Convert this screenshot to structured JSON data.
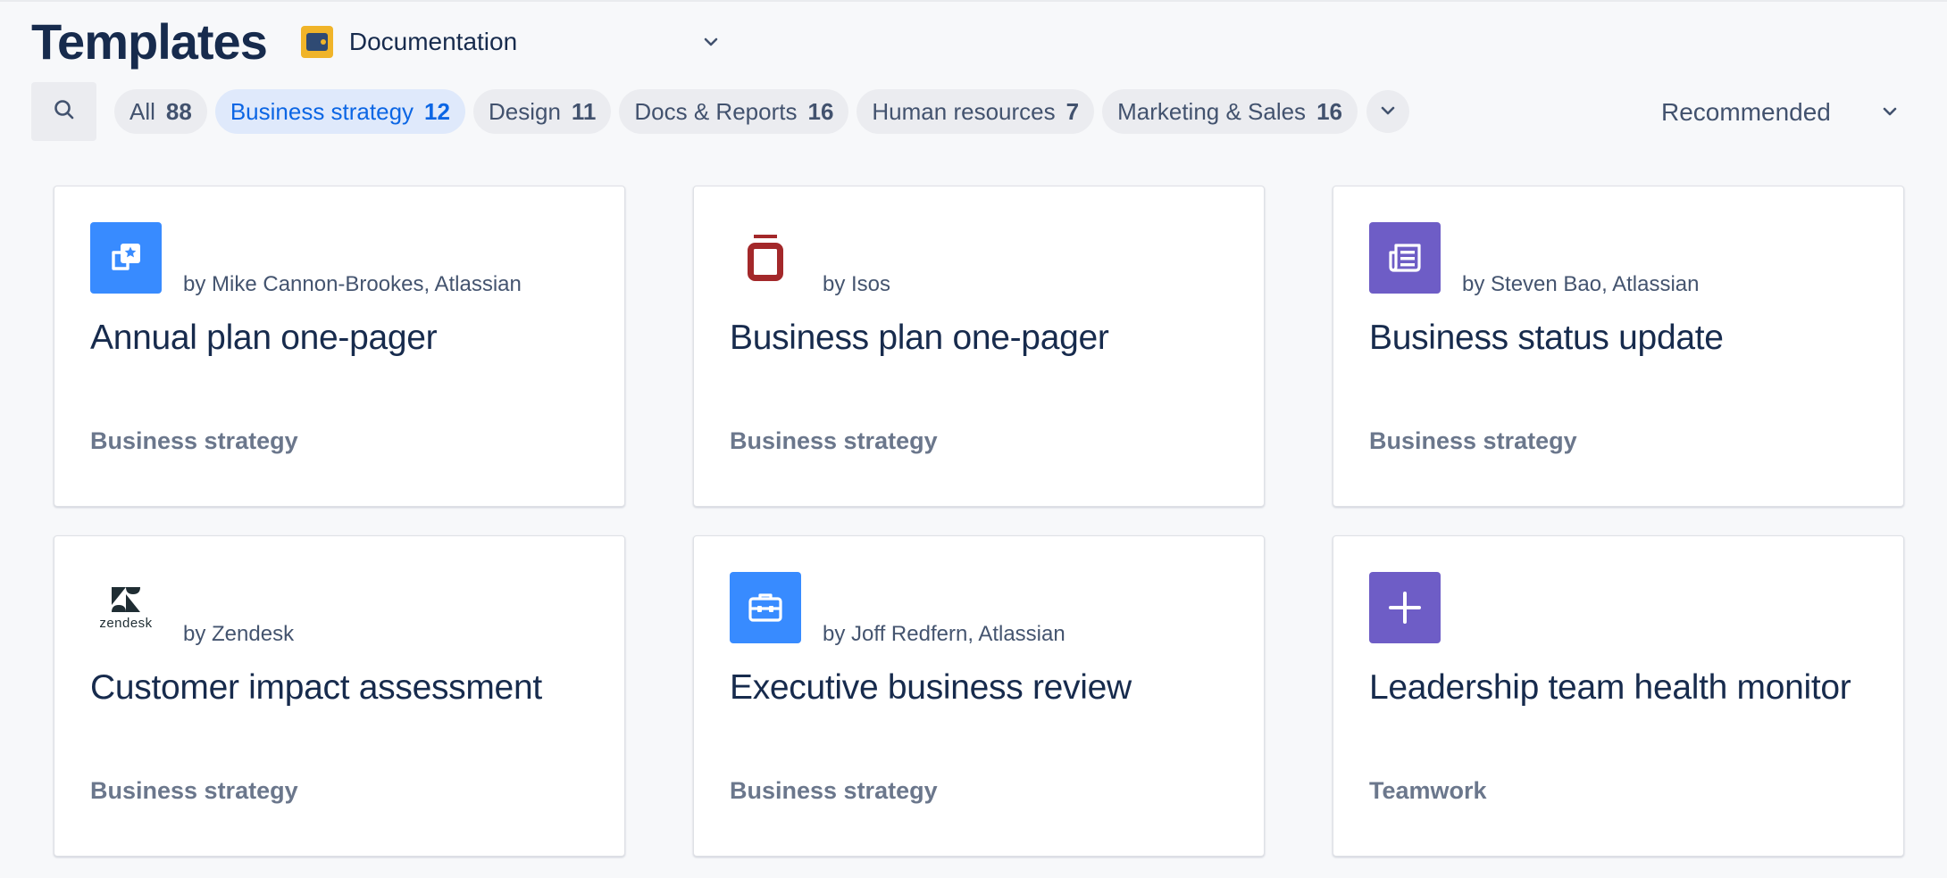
{
  "header": {
    "title": "Templates",
    "space": {
      "name": "Documentation",
      "icon": "space-avatar-icon"
    }
  },
  "filters": {
    "search_icon": "search-icon",
    "chips": [
      {
        "label": "All",
        "count": "88",
        "active": false
      },
      {
        "label": "Business strategy",
        "count": "12",
        "active": true
      },
      {
        "label": "Design",
        "count": "11",
        "active": false
      },
      {
        "label": "Docs & Reports",
        "count": "16",
        "active": false
      },
      {
        "label": "Human resources",
        "count": "7",
        "active": false
      },
      {
        "label": "Marketing & Sales",
        "count": "16",
        "active": false
      }
    ],
    "more_icon": "chevron-down-icon"
  },
  "sort": {
    "label": "Recommended"
  },
  "cards": [
    {
      "author": "by Mike Cannon-Brookes, Atlassian",
      "title": "Annual plan one-pager",
      "category": "Business strategy",
      "icon": "star-document-icon",
      "icon_bg": "#388bff"
    },
    {
      "author": "by Isos",
      "title": "Business plan one-pager",
      "category": "Business strategy",
      "icon": "isos-logo-icon",
      "icon_bg": "transparent"
    },
    {
      "author": "by Steven Bao, Atlassian",
      "title": "Business status update",
      "category": "Business strategy",
      "icon": "newspaper-icon",
      "icon_bg": "#6e5dc6"
    },
    {
      "author": "by Zendesk",
      "title": "Customer impact assessment",
      "category": "Business strategy",
      "icon": "zendesk-logo-icon",
      "icon_bg": "transparent",
      "logo_text": "zendesk"
    },
    {
      "author": "by Joff Redfern, Atlassian",
      "title": "Executive business review",
      "category": "Business strategy",
      "icon": "briefcase-icon",
      "icon_bg": "#388bff"
    },
    {
      "author": "",
      "title": "Leadership team health monitor",
      "category": "Teamwork",
      "icon": "plus-icon",
      "icon_bg": "#6e5dc6"
    }
  ],
  "colors": {
    "accent": "#0c66e4",
    "active_chip_bg": "#dfe9fb",
    "chip_bg": "#ebecf0",
    "text_primary": "#172b4d",
    "text_muted": "#6b778c"
  }
}
